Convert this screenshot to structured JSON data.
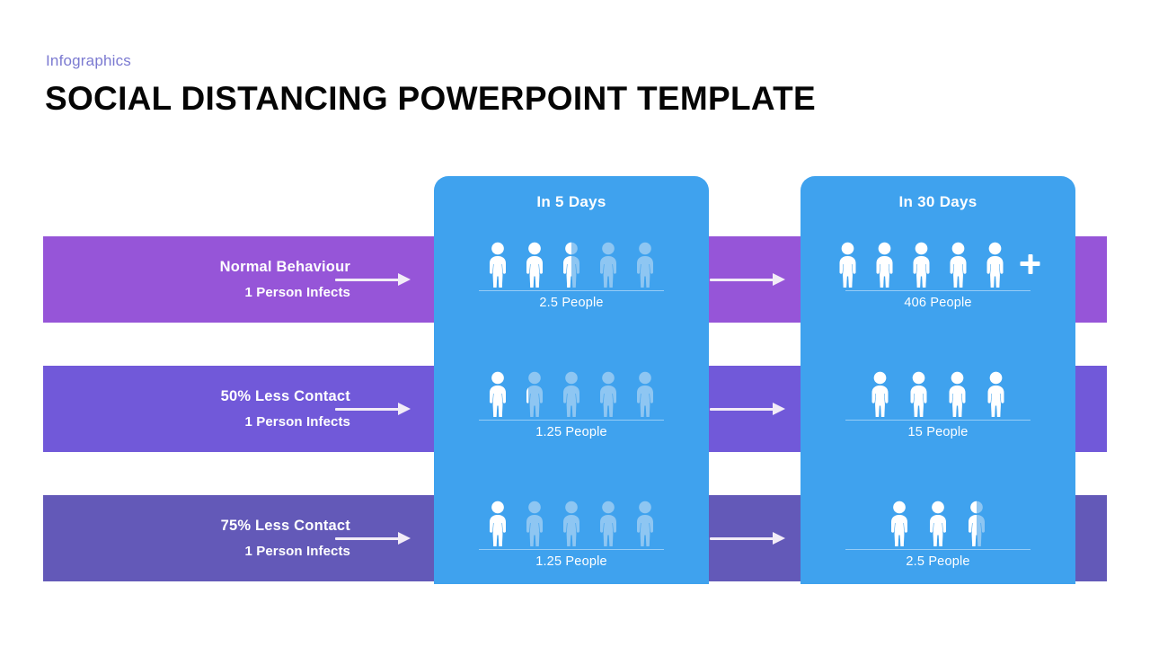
{
  "header": {
    "eyebrow": "Infographics",
    "title": "SOCIAL DISTANCING POWERPOINT TEMPLATE"
  },
  "columns": [
    {
      "id": "days5",
      "label": "In 5 Days"
    },
    {
      "id": "days30",
      "label": "In 30 Days"
    }
  ],
  "colors": {
    "row1": "#9655d8",
    "row2": "#7159d9",
    "row3": "#6359b8",
    "column_blue": "#3fa2ee",
    "eyebrow": "#7b7ad1",
    "title": "#050505",
    "arrow": "#f2ecf7",
    "person_full": "#ffffff",
    "person_faded": "#8ec6f2"
  },
  "rows": [
    {
      "title": "Normal  Behaviour",
      "subtitle": "1 Person Infects",
      "days5": {
        "count_label": "2.5 People",
        "icons_total": 5,
        "icons_filled": 2.5,
        "has_plus": false
      },
      "days30": {
        "count_label": "406 People",
        "icons_total": 5,
        "icons_filled": 5,
        "has_plus": true
      }
    },
    {
      "title": "50% Less Contact",
      "subtitle": "1 Person Infects",
      "days5": {
        "count_label": "1.25 People",
        "icons_total": 5,
        "icons_filled": 1.25,
        "has_plus": false
      },
      "days30": {
        "count_label": "15 People",
        "icons_total": 4,
        "icons_filled": 4,
        "has_plus": false
      }
    },
    {
      "title": "75% Less Contact",
      "subtitle": "1 Person Infects",
      "days5": {
        "count_label": "1.25 People",
        "icons_total": 5,
        "icons_filled": 0.9,
        "has_plus": false
      },
      "days30": {
        "count_label": "2.5 People",
        "icons_total": 3,
        "icons_filled": 2.5,
        "has_plus": false
      }
    }
  ],
  "icons": {
    "arrow": "arrow-right-icon",
    "person": "person-icon",
    "plus": "plus-icon"
  }
}
